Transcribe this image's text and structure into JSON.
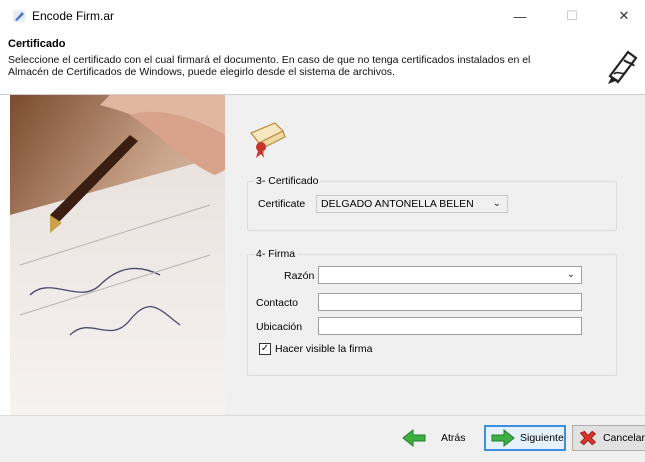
{
  "window": {
    "title": "Encode Firm.ar",
    "minimize": "—",
    "maximize": "☐",
    "close": "✕"
  },
  "header": {
    "title": "Certificado",
    "description": "Seleccione el certificado con el cual firmará el documento. En caso de que no tenga certificados instalados en el Almacén de Certificados de Windows, puede elegirlo desde el sistema de archivos."
  },
  "certificado": {
    "legend": "3- Certificado",
    "label": "Certificate",
    "selected": "DELGADO ANTONELLA BELEN"
  },
  "firma": {
    "legend": "4- Firma",
    "razon_label": "Razón",
    "razon_value": "",
    "contacto_label": "Contacto",
    "contacto_value": "",
    "ubicacion_label": "Ubicación",
    "ubicacion_value": "",
    "visible_label": "Hacer visible la firma",
    "visible_checked": true
  },
  "buttons": {
    "back": "Atrás",
    "next": "Siguiente",
    "cancel": "Cancelar"
  },
  "icons": {
    "app": "edit-pen-icon",
    "header": "signature-pen-icon",
    "scroll": "certificate-scroll-icon",
    "back": "arrow-left-icon",
    "next": "arrow-right-icon",
    "cancel": "cancel-x-icon"
  },
  "colors": {
    "accent": "#3d8ee0",
    "arrow_green": "#3cb043",
    "cancel_red": "#d9342b"
  }
}
